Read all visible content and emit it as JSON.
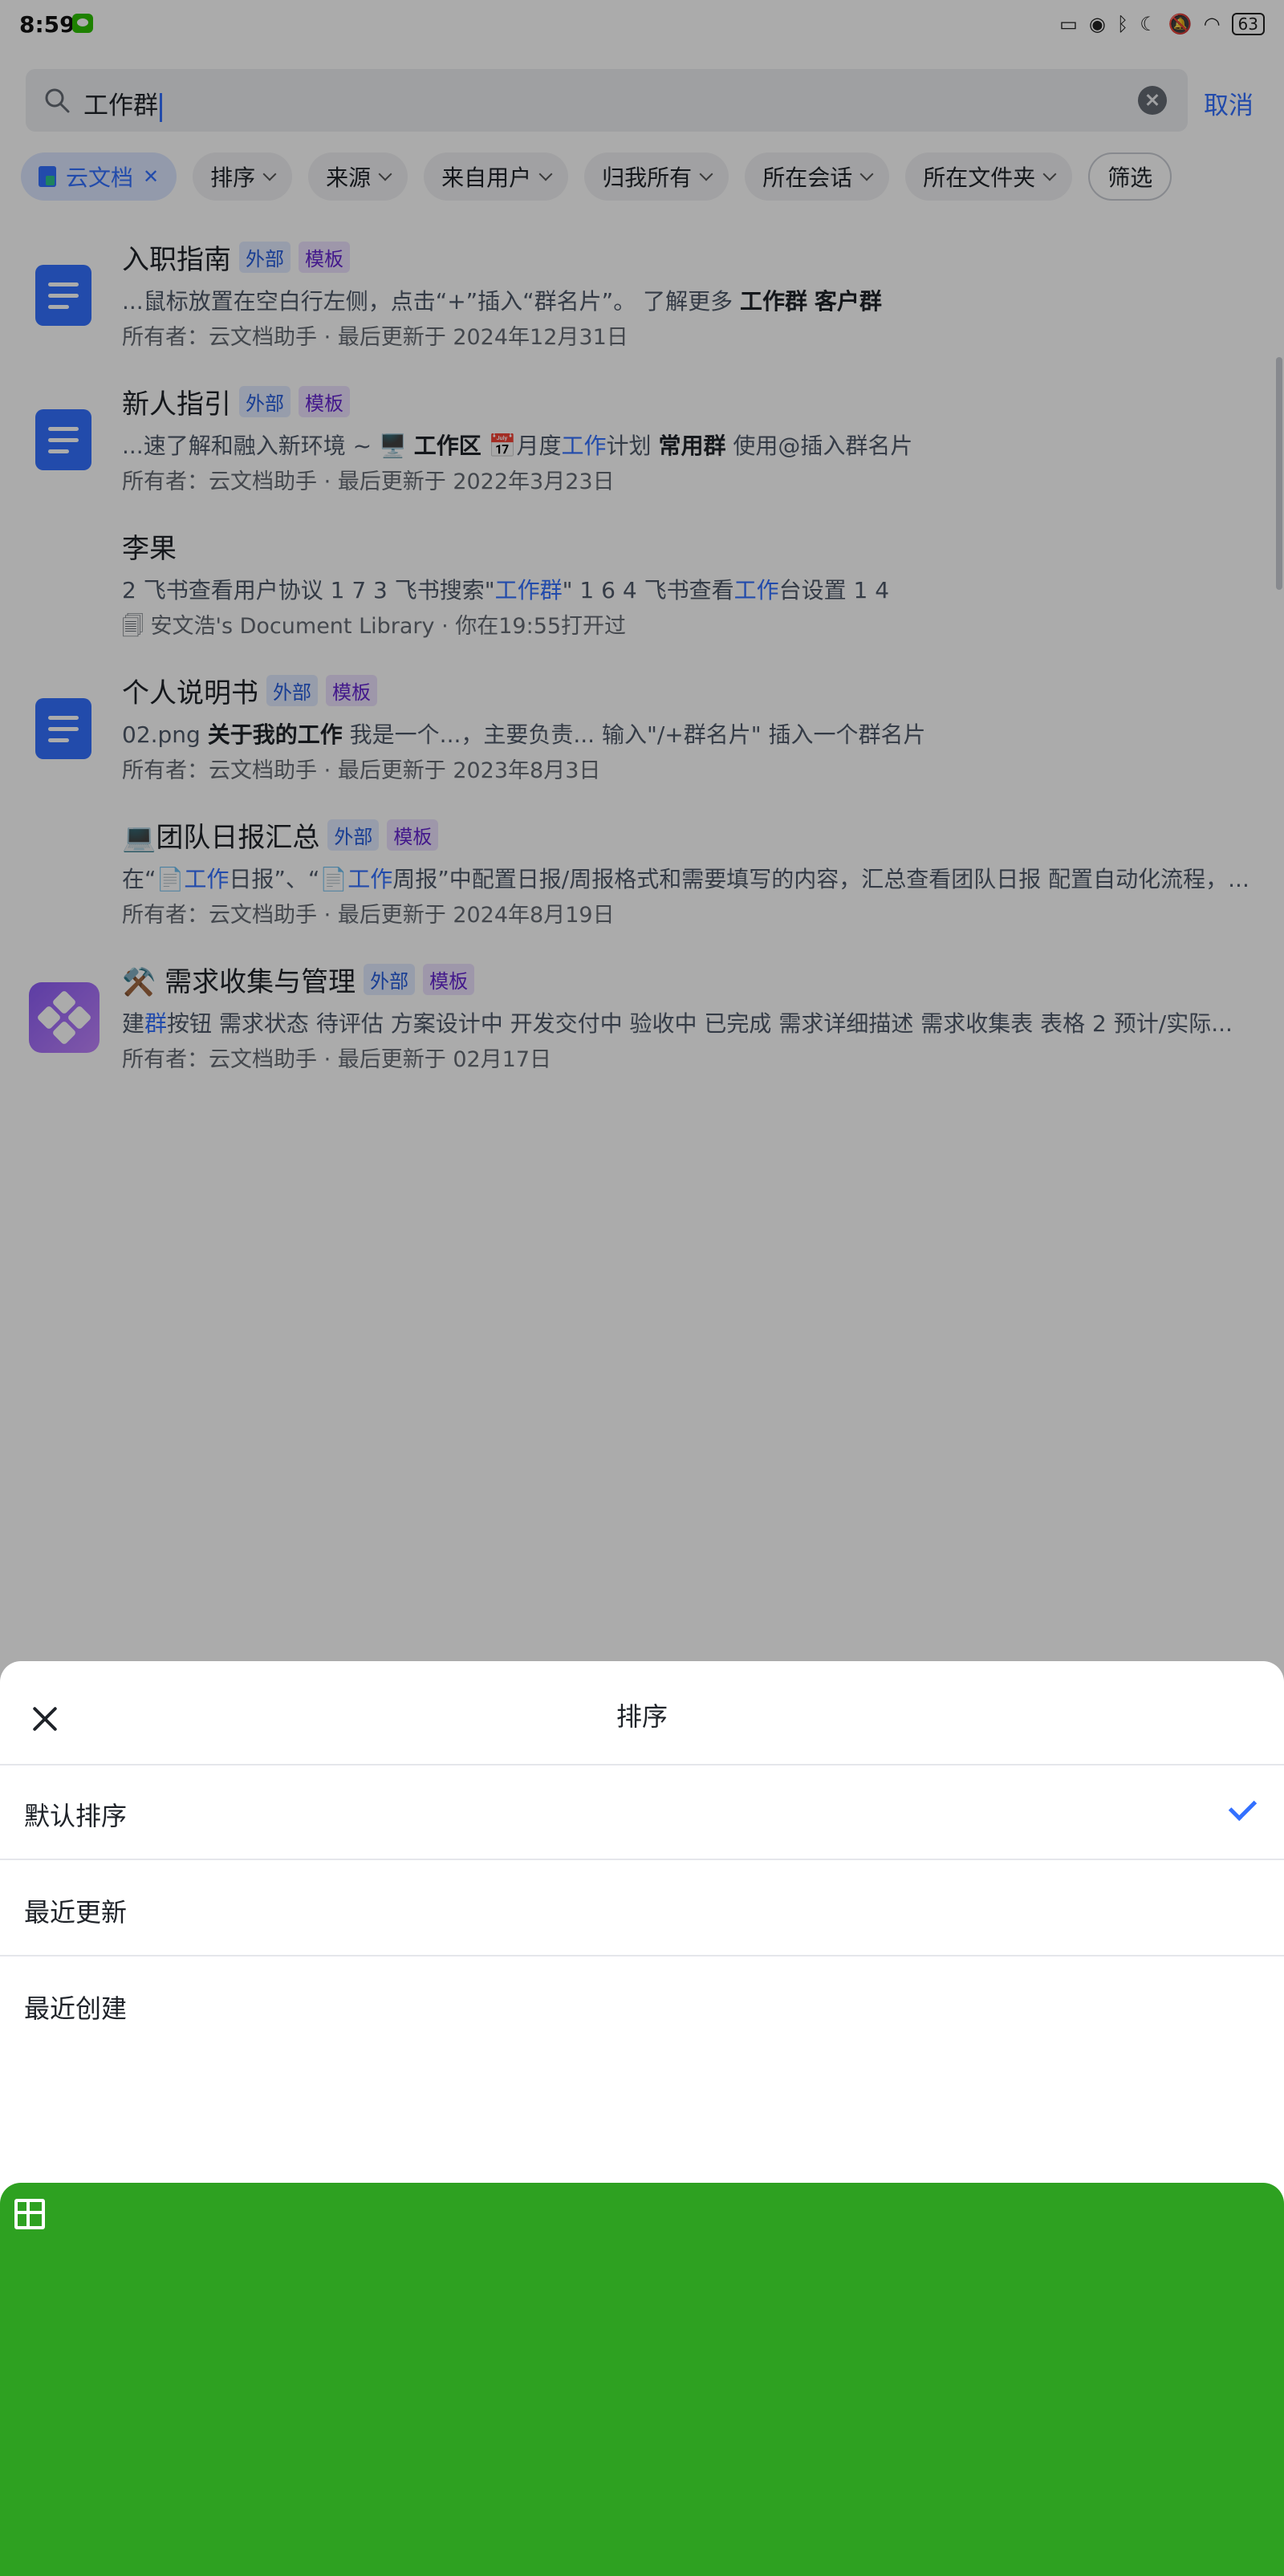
{
  "status_bar": {
    "time": "8:59",
    "battery": "63"
  },
  "search": {
    "query": "工作群",
    "cancel_label": "取消"
  },
  "filters": [
    {
      "label": "云文档",
      "active": true
    },
    {
      "label": "排序"
    },
    {
      "label": "来源"
    },
    {
      "label": "来自用户"
    },
    {
      "label": "归我所有"
    },
    {
      "label": "所在会话"
    },
    {
      "label": "所在文件夹"
    },
    {
      "label": "筛选"
    }
  ],
  "results": [
    {
      "title": "入职指南",
      "tags": [
        "外部",
        "模板"
      ],
      "snippet": [
        {
          "t": "...鼠标放置在空白行左侧，点击“+”插入“群名片”。   了解更多   "
        },
        {
          "t": "工作群",
          "s": "hlb"
        },
        {
          "t": "  "
        },
        {
          "t": "客户群",
          "s": "b"
        }
      ],
      "meta": "所有者：云文档助手 · 最后更新于 2024年12月31日",
      "icon": "doc-icon"
    },
    {
      "title": "新人指引",
      "tags": [
        "外部",
        "模板"
      ],
      "snippet": [
        {
          "t": "...速了解和融入新环境 ~   🖥️  "
        },
        {
          "t": "工作区",
          "s": "hlb"
        },
        {
          "t": "   📅月度"
        },
        {
          "t": "工作",
          "s": "hl"
        },
        {
          "t": "计划    "
        },
        {
          "t": "常用群",
          "s": "b"
        },
        {
          "t": "   使用@插入群名片"
        }
      ],
      "meta": "所有者：云文档助手 · 最后更新于 2022年3月23日",
      "icon": "doc-icon"
    },
    {
      "title": "李果",
      "tags": [],
      "snippet": [
        {
          "t": "2 飞书查看用户协议 1 7   3 飞书搜索\""
        },
        {
          "t": "工作群",
          "s": "hl"
        },
        {
          "t": "\" 1 6   4 飞书查看"
        },
        {
          "t": "工作",
          "s": "hl"
        },
        {
          "t": "台设置 1 4"
        }
      ],
      "meta": "🗐 安文浩's Document Library · 你在19:55打开过",
      "icon": "sheet-icon"
    },
    {
      "title": "个人说明书",
      "tags": [
        "外部",
        "模板"
      ],
      "snippet": [
        {
          "t": "02.png   "
        },
        {
          "t": "关于我的",
          "s": "b"
        },
        {
          "t": "工作",
          "s": "hlb"
        },
        {
          "t": "   我是一个...，主要负责...   输入\"/+群名片\" 插入一个群名片"
        }
      ],
      "meta": "所有者：云文档助手 · 最后更新于 2023年8月3日",
      "icon": "doc-icon"
    },
    {
      "title": "💻团队日报汇总",
      "tags": [
        "外部",
        "模板"
      ],
      "snippet": [
        {
          "t": "在“📄"
        },
        {
          "t": "工作",
          "s": "hl"
        },
        {
          "t": "日报”、“📄"
        },
        {
          "t": "工作",
          "s": "hl"
        },
        {
          "t": "周报”中配置日报/周报格式和需要填写的内容，汇总查看团队日报   配置自动化流程，..."
        }
      ],
      "meta": "所有者：云文档助手 · 最后更新于 2024年8月19日",
      "icon": "none"
    },
    {
      "title": "⚒️ 需求收集与管理",
      "tags": [
        "外部",
        "模板"
      ],
      "snippet": [
        {
          "t": "建"
        },
        {
          "t": "群",
          "s": "hl"
        },
        {
          "t": "按钮 需求状态 待评估 方案设计中 开发交付中 验收中 已完成 需求详细描述   需求收集表 表格 2 预计/实际..."
        }
      ],
      "meta": "所有者：云文档助手 · 最后更新于 02月17日",
      "icon": "base-icon"
    }
  ],
  "sort_sheet": {
    "title": "排序",
    "options": [
      "默认排序",
      "最近更新",
      "最近创建"
    ],
    "selected": "默认排序"
  }
}
